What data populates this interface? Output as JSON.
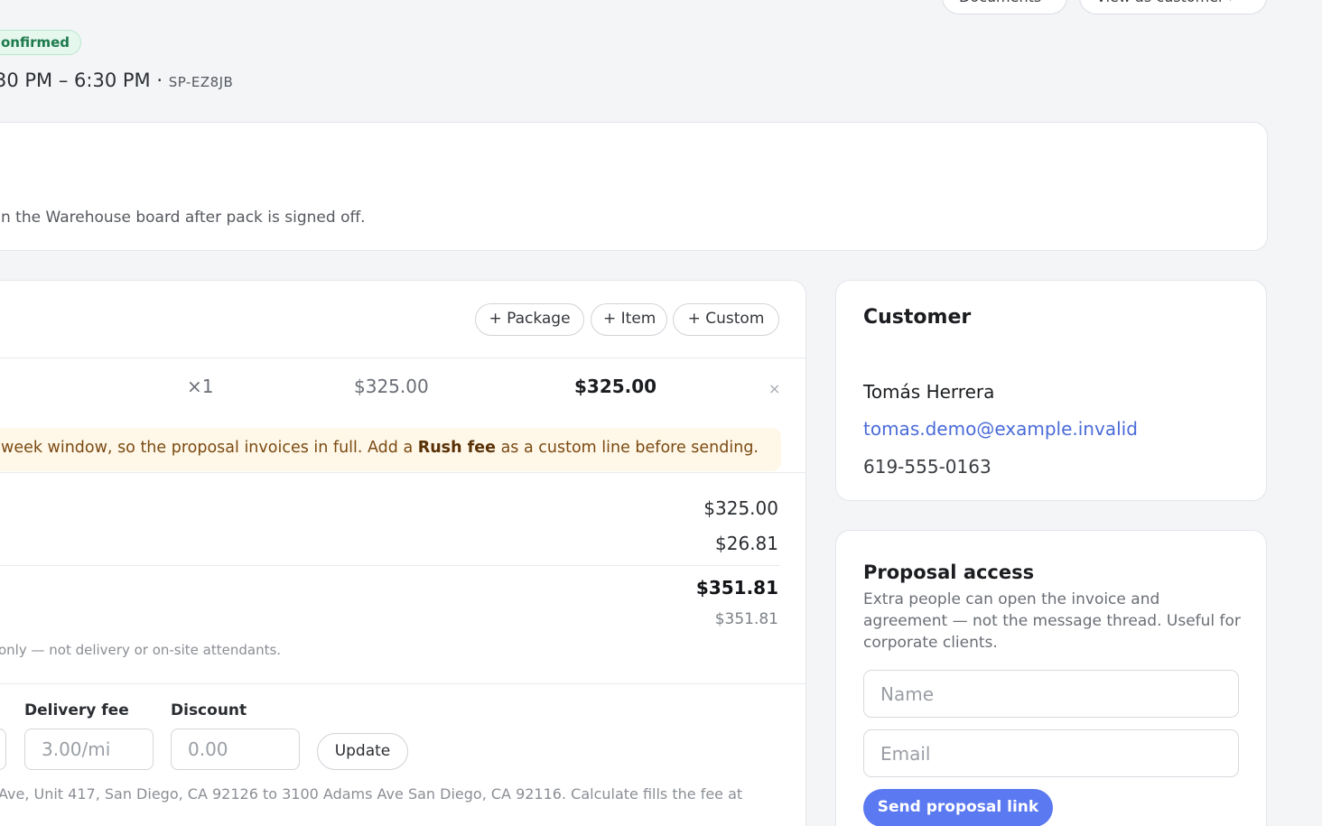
{
  "header": {
    "buttons": [
      "Documents",
      "View as customer ›"
    ],
    "status_badge": "onfirmed",
    "time_range": "30 PM – 6:30 PM",
    "ref_sep": " · ",
    "ref": "SP-EZ8JB"
  },
  "note": {
    "text": "n the Warehouse board after pack is signed off."
  },
  "items": {
    "add_buttons": [
      "+ Package",
      "+ Item",
      "+ Custom"
    ],
    "rows": [
      {
        "qty": "×1",
        "unit_price": "$325.00",
        "total": "$325.00",
        "remove_icon": "close-icon"
      }
    ],
    "warning": {
      "before": "week window, so the proposal invoices in full. Add a ",
      "bold": "Rush fee",
      "after": " as a custom line before sending."
    },
    "totals": {
      "subtotal": "$325.00",
      "tax": "$26.81",
      "total": "$351.81",
      "total_sub": "$351.81"
    },
    "tax_note": "only — not delivery or on-site attendants.",
    "fields": {
      "delivery_fee_label": "Delivery fee",
      "delivery_fee_placeholder": "3.00/mi",
      "discount_label": "Discount",
      "discount_placeholder": "0.00",
      "update_label": "Update"
    },
    "route_note": "Ave, Unit 417, San Diego, CA 92126 to 3100 Adams Ave San Diego, CA 92116. Calculate fills the fee at"
  },
  "customer": {
    "title": "Customer",
    "name": "Tomás Herrera",
    "email": "tomas.demo@example.invalid",
    "phone": "619-555-0163"
  },
  "proposal_access": {
    "title": "Proposal access",
    "description": "Extra people can open the invoice and agreement — not the message thread. Useful for corporate clients.",
    "name_placeholder": "Name",
    "email_placeholder": "Email",
    "send_label": "Send proposal link"
  },
  "colors": {
    "accent": "#5b79f0",
    "link": "#4a6bd8",
    "badge_green": "#1d7a4c",
    "warning_bg": "#fff8e8"
  }
}
